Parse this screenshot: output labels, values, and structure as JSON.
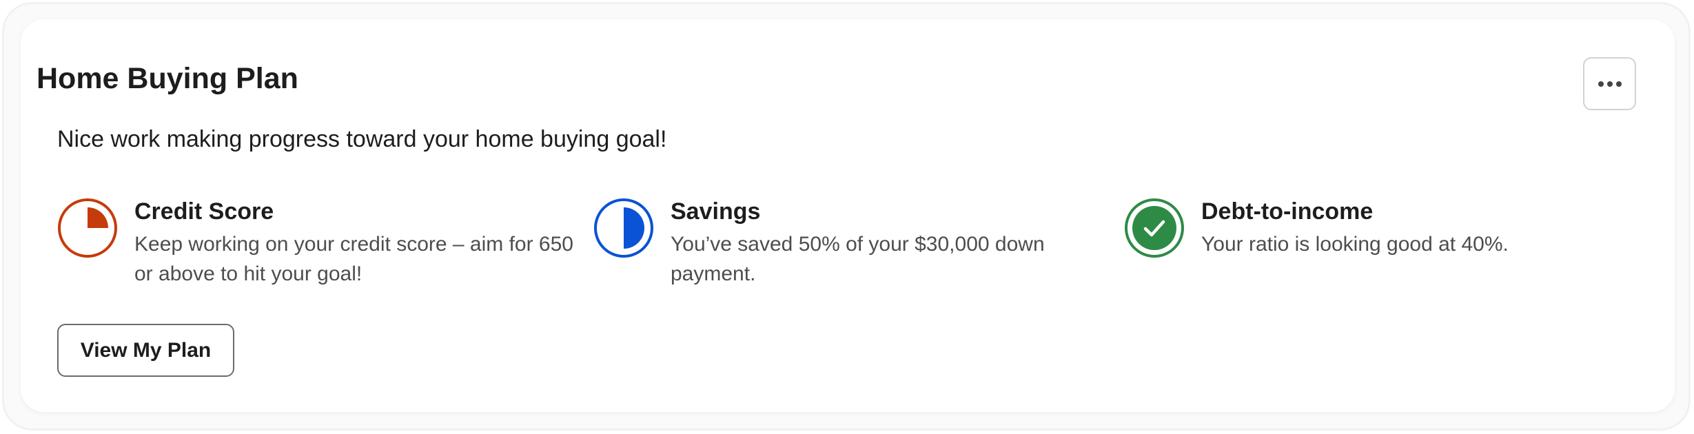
{
  "card": {
    "title": "Home Buying Plan",
    "subtitle": "Nice work making progress toward your home buying goal!",
    "menu_icon": "more-horizontal-icon"
  },
  "items": [
    {
      "title": "Credit Score",
      "description": "Keep working on your credit score – aim for 650 or above to hit your goal!",
      "icon": "quarter-pie-icon",
      "color": "#c63b0c",
      "progress": 0.25
    },
    {
      "title": "Savings",
      "description": "You’ve saved 50% of your $30,000 down payment.",
      "icon": "half-pie-icon",
      "color": "#0a52d6",
      "progress": 0.5
    },
    {
      "title": "Debt-to-income",
      "description": "Your ratio is looking good at 40%.",
      "icon": "check-circle-icon",
      "color": "#2e8b46",
      "progress": 1
    }
  ],
  "actions": {
    "view_plan_label": "View My Plan"
  }
}
